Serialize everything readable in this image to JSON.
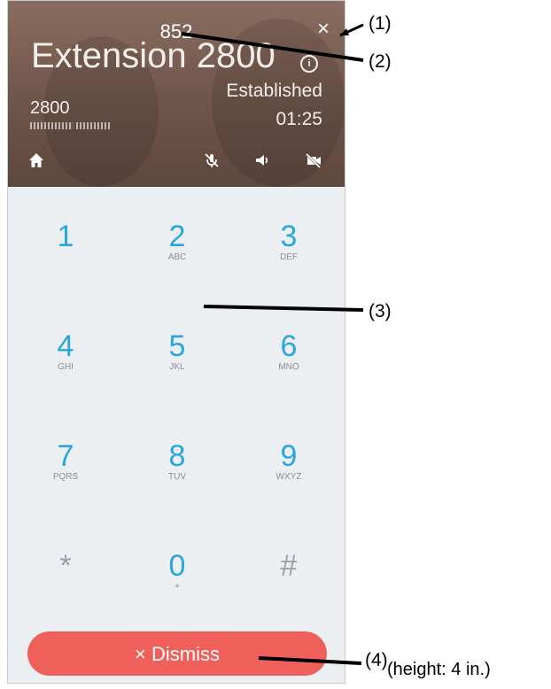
{
  "call": {
    "dialed_digits": "852",
    "contact_name": "Extension 2800",
    "status": "Established",
    "extension": "2800",
    "timer": "01:25"
  },
  "controls": {
    "close_glyph": "×",
    "info_glyph": "i",
    "icons": [
      "home-icon",
      "mute-microphone-icon",
      "speaker-icon",
      "video-off-icon"
    ]
  },
  "keypad": {
    "keys": [
      {
        "digit": "1",
        "letters": ""
      },
      {
        "digit": "2",
        "letters": "ABC"
      },
      {
        "digit": "3",
        "letters": "DEF"
      },
      {
        "digit": "4",
        "letters": "GHI"
      },
      {
        "digit": "5",
        "letters": "JKL"
      },
      {
        "digit": "6",
        "letters": "MNO"
      },
      {
        "digit": "7",
        "letters": "PQRS"
      },
      {
        "digit": "8",
        "letters": "TUV"
      },
      {
        "digit": "9",
        "letters": "WXYZ"
      },
      {
        "digit": "*",
        "letters": ""
      },
      {
        "digit": "0",
        "letters": "+"
      },
      {
        "digit": "#",
        "letters": ""
      }
    ]
  },
  "dismiss": {
    "label": "× Dismiss"
  },
  "annotations": {
    "c1": "(1)",
    "c2": "(2)",
    "c3": "(3)",
    "c4": "(4)",
    "height_note": "(height: 4 in.)"
  },
  "colors": {
    "header": "#6e5549",
    "keypad_bg": "#eceff2",
    "digit": "#2aa6df",
    "dismiss": "#f0605a"
  }
}
